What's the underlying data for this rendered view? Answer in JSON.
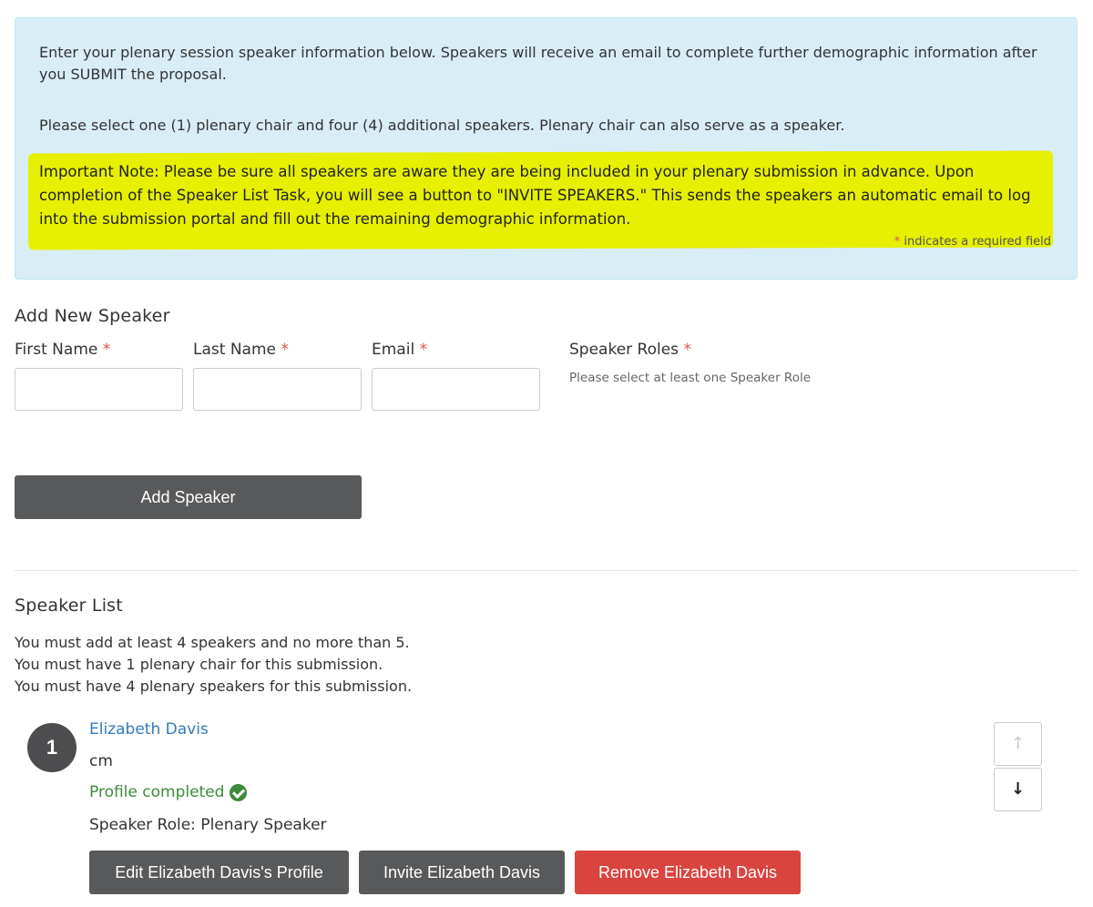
{
  "info": {
    "paragraph1": "Enter your plenary session speaker information below. Speakers will receive an email to complete further demographic information after you SUBMIT the proposal.",
    "paragraph2": "Please select one (1) plenary chair and four (4) additional speakers. Plenary chair can also serve as a speaker.",
    "important_note": "Important Note: Please be sure all speakers are aware they are being included in your plenary submission in advance. Upon completion of the Speaker List Task, you will see a button to \"INVITE SPEAKERS.\" This sends the speakers an automatic email to log into the submission portal and fill out the remaining demographic information.",
    "required_asterisk": "*",
    "required_text": " indicates a required field"
  },
  "add_speaker": {
    "title": "Add New Speaker",
    "first_name_label": "First Name",
    "last_name_label": "Last Name",
    "email_label": "Email",
    "roles_label": "Speaker Roles",
    "required_marker": "*",
    "first_name_value": "",
    "last_name_value": "",
    "email_value": "",
    "roles_help": "Please select at least one Speaker Role",
    "add_button": "Add Speaker"
  },
  "speaker_list": {
    "title": "Speaker List",
    "rules": [
      "You must add at least 4 speakers and no more than 5.",
      "You must have 1 plenary chair for this submission.",
      "You must have 4 plenary speakers for this submission."
    ],
    "speakers": [
      {
        "number": "1",
        "name": "Elizabeth Davis",
        "credential": "cm",
        "status": "Profile completed",
        "role": "Speaker Role: Plenary Speaker",
        "edit_button": "Edit Elizabeth Davis's Profile",
        "invite_button": "Invite Elizabeth Davis",
        "remove_button": "Remove Elizabeth Davis",
        "move_up_icon": "↑",
        "move_down_icon": "↓"
      }
    ]
  },
  "colors": {
    "info_background": "#d9edf7",
    "highlight": "#e6f000",
    "link": "#337ab7",
    "success": "#3c8b3c",
    "danger": "#d9443f",
    "dark_button": "#58595b"
  }
}
